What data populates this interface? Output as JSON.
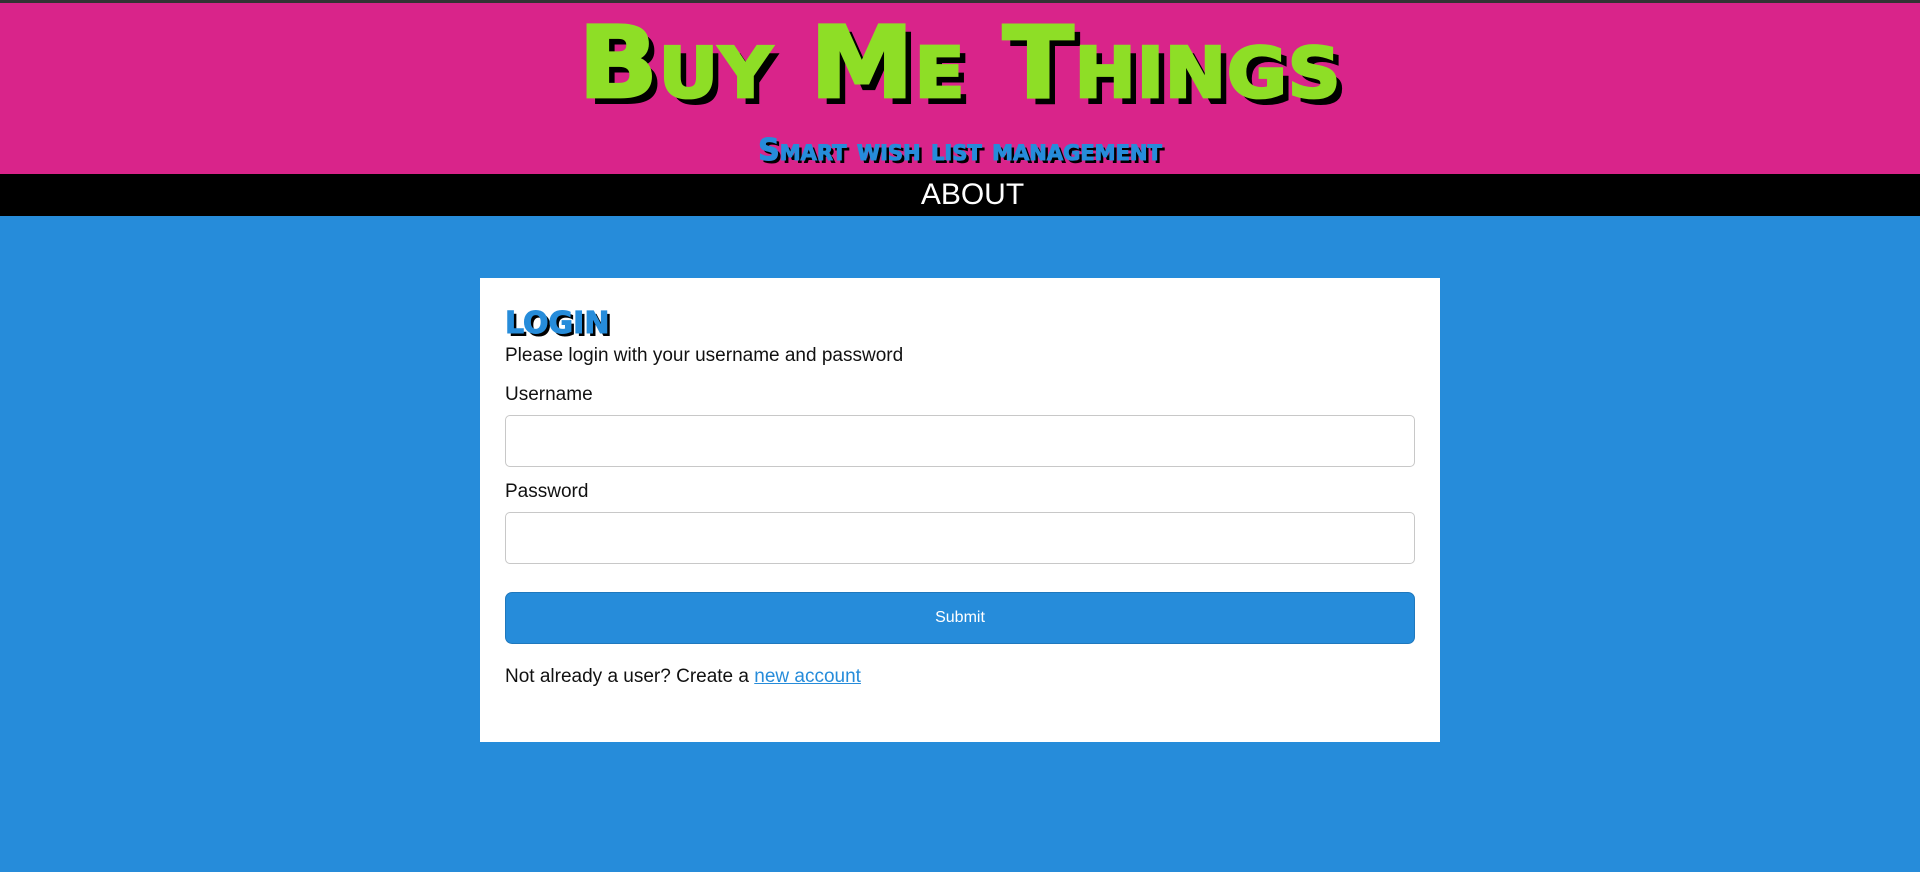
{
  "header": {
    "title": "Buy Me Things",
    "subtitle": "Smart wish list management"
  },
  "nav": {
    "items": [
      {
        "label": "ABOUT"
      }
    ]
  },
  "login": {
    "heading": "LOGIN",
    "subtitle": "Please login with your username and password",
    "username_label": "Username",
    "username_value": "",
    "password_label": "Password",
    "password_value": "",
    "submit_label": "Submit",
    "signup_prompt": "Not already a user? Create a ",
    "signup_link": "new account"
  },
  "colors": {
    "header_bg": "#d9248a",
    "title": "#8ede26",
    "page_bg": "#268cda",
    "nav_bg": "#000000",
    "card_bg": "#ffffff"
  }
}
